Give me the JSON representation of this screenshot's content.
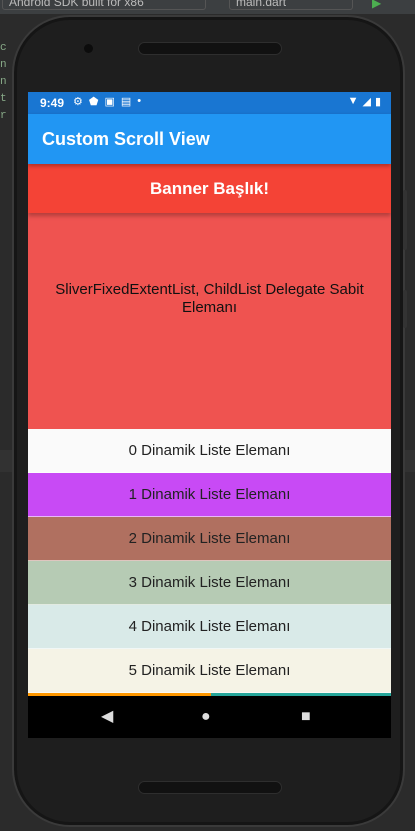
{
  "ide": {
    "left_tab": "Android SDK built for x86",
    "right_tab": "main.dart",
    "side_glyphs": [
      "c",
      "n",
      "n",
      "t",
      "r"
    ]
  },
  "status": {
    "time": "9:49",
    "left_icons": [
      "gear-icon",
      "shield-icon",
      "a-icon",
      "image-icon",
      "dot-icon"
    ],
    "right_icons": [
      "wifi-icon",
      "signal-icon",
      "battery-icon"
    ]
  },
  "app": {
    "title": "Custom Scroll View",
    "colors": {
      "appbar": "#2196f3",
      "statusbar": "#1976d2"
    }
  },
  "banner": {
    "text": "Banner Başlık!",
    "color": "#f44336"
  },
  "fixed_item": {
    "text": "SliverFixedExtentList, ChildList Delegate Sabit Elemanı",
    "color": "#ef5350"
  },
  "list": {
    "items": [
      {
        "label": "0 Dinamik Liste Elemanı",
        "color": "#fafafa"
      },
      {
        "label": "1 Dinamik Liste Elemanı",
        "color": "#c84af5"
      },
      {
        "label": "2 Dinamik Liste Elemanı",
        "color": "#b07060"
      },
      {
        "label": "3 Dinamik Liste Elemanı",
        "color": "#b6cbb4"
      },
      {
        "label": "4 Dinamik Liste Elemanı",
        "color": "#d9eae8"
      },
      {
        "label": "5 Dinamik Liste Elemanı",
        "color": "#f5f3e6"
      }
    ]
  },
  "navbar": {
    "back": "◀",
    "home": "●",
    "recents": "■"
  }
}
